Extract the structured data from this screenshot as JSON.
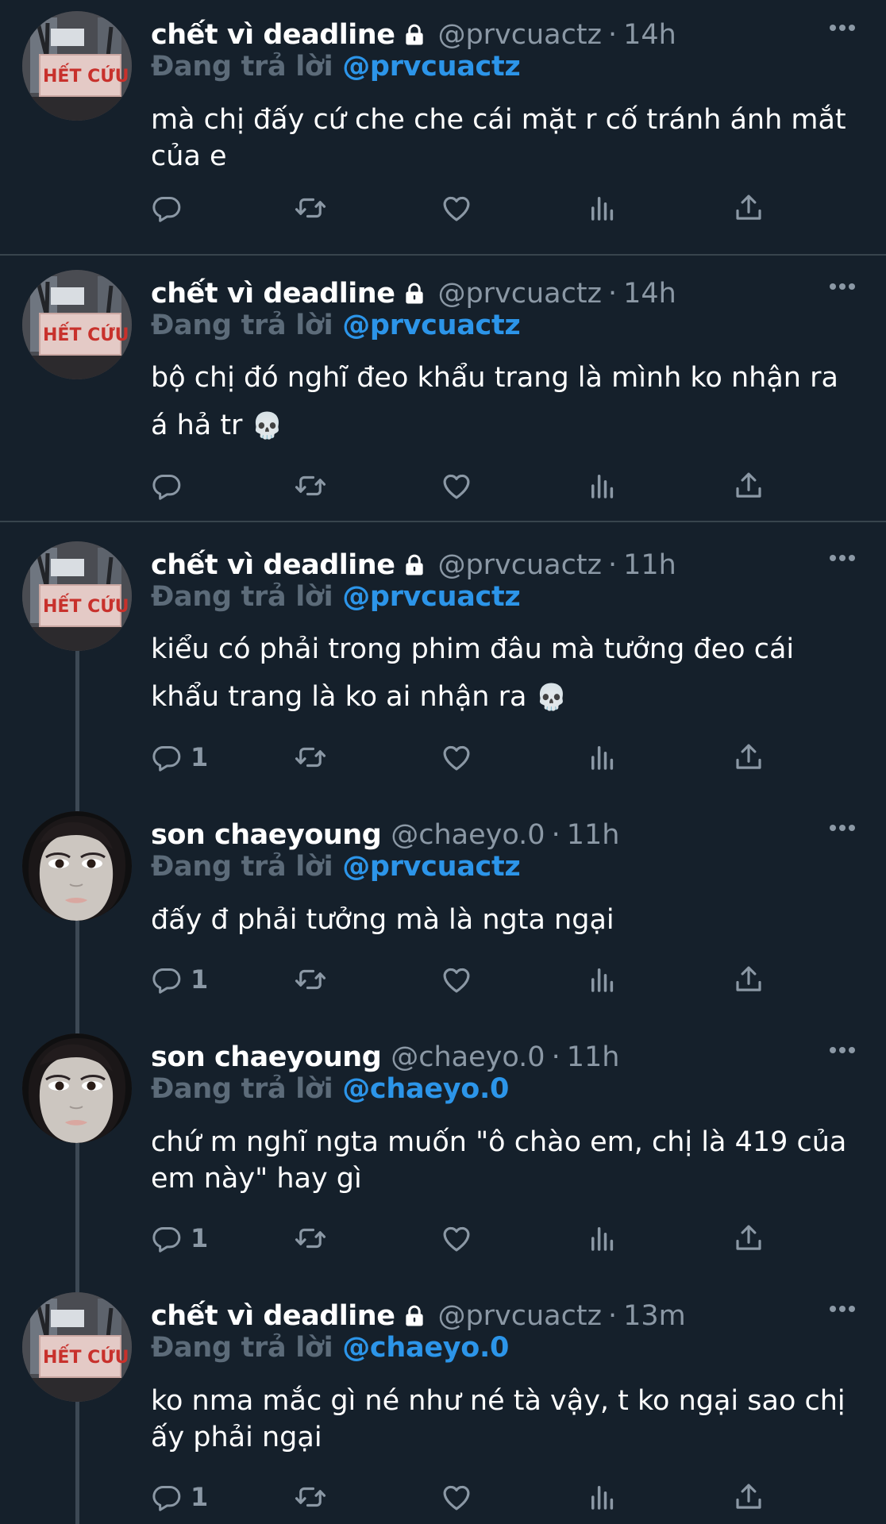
{
  "reply_prefix": "Đang trả lời",
  "tweets": [
    {
      "name": "chết vì deadline",
      "handle": "@prvcuactz",
      "separator": "·",
      "time": "14h",
      "reply_to": "@prvcuactz",
      "text": "mà chị đấy cứ che che cái mặt r cố tránh ánh mắt của e",
      "reply_count": "",
      "avatar": "het-cuu-sign",
      "protected": true,
      "avatar_label": "HẾT CỨU"
    },
    {
      "name": "chết vì deadline",
      "handle": "@prvcuactz",
      "separator": "·",
      "time": "14h",
      "reply_to": "@prvcuactz",
      "text": "bộ chị đó nghĩ đeo khẩu trang là mình ko nhận ra á hả tr",
      "emoji": "💀",
      "reply_count": "",
      "avatar": "het-cuu-sign",
      "protected": true,
      "avatar_label": "HẾT CỨU"
    },
    {
      "name": "chết vì deadline",
      "handle": "@prvcuactz",
      "separator": "·",
      "time": "11h",
      "reply_to": "@prvcuactz",
      "text": "kiểu có phải trong phim đâu mà tưởng đeo cái khẩu trang là ko ai nhận ra",
      "emoji": "💀",
      "reply_count": "1",
      "avatar": "het-cuu-sign",
      "protected": true,
      "avatar_label": "HẾT CỨU"
    },
    {
      "name": "son chaeyoung",
      "handle": "@chaeyo.0",
      "separator": "·",
      "time": "11h",
      "reply_to": "@prvcuactz",
      "text": "đấy đ phải tưởng mà là ngta ngại",
      "reply_count": "1",
      "avatar": "face-mask-portrait",
      "protected": false
    },
    {
      "name": "son chaeyoung",
      "handle": "@chaeyo.0",
      "separator": "·",
      "time": "11h",
      "reply_to": "@chaeyo.0",
      "text": "chứ m nghĩ ngta muốn \"ô chào em, chị là 419 của em này\" hay gì",
      "reply_count": "1",
      "avatar": "face-mask-portrait",
      "protected": false
    },
    {
      "name": "chết vì deadline",
      "handle": "@prvcuactz",
      "separator": "·",
      "time": "13m",
      "reply_to": "@chaeyo.0",
      "text": "ko nma mắc gì né như né tà vậy, t ko ngại sao chị ấy phải ngại",
      "reply_count": "1",
      "avatar": "het-cuu-sign",
      "protected": true,
      "avatar_label": "HẾT CỨU"
    }
  ],
  "icons": [
    "reply-icon",
    "retweet-icon",
    "like-icon",
    "analytics-icon",
    "share-icon",
    "more-icon",
    "lock-icon"
  ],
  "colors": {
    "background": "#15202b",
    "separator": "#38444d",
    "muted": "#8b98a5",
    "reply_prefix": "#5c6b79",
    "accent": "#2c95e9"
  }
}
